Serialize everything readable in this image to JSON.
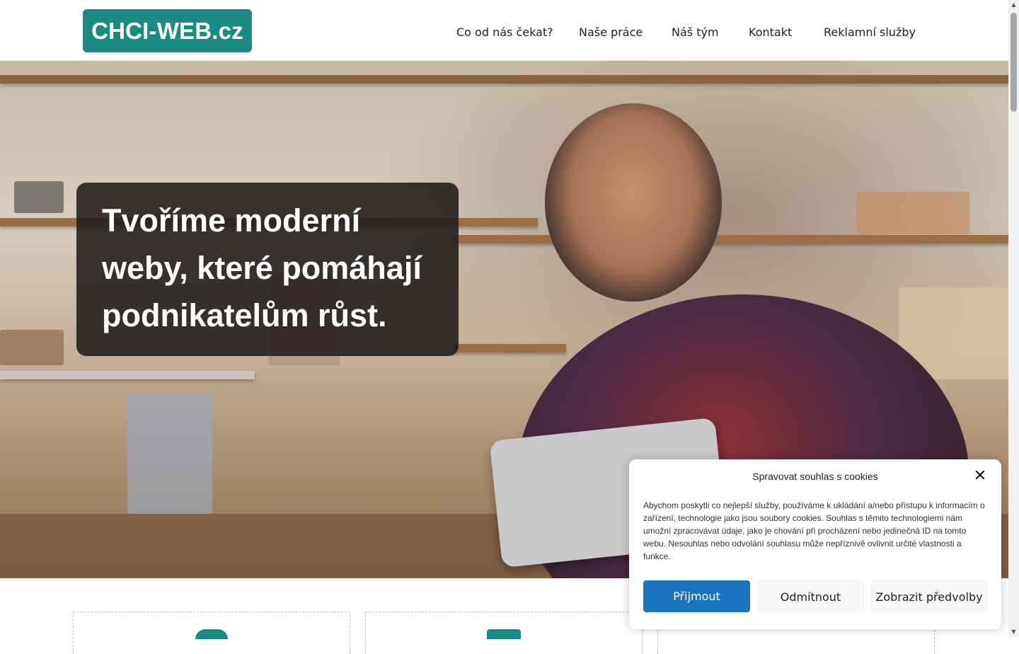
{
  "header": {
    "logo_text": "CHCI-WEB.cz",
    "nav": [
      "Co od nás čekat?",
      "Naše práce",
      "Náš tým",
      "Kontakt",
      "Reklamní služby"
    ]
  },
  "hero": {
    "title_lines": [
      "Tvoříme moderní",
      "weby, které pomáhají",
      "podnikatelům růst."
    ]
  },
  "cookie": {
    "title": "Spravovat souhlas s cookies",
    "text": "Abychom poskytli co nejlepší služby, používáme k ukládání a/nebo přístupu k informacím o zařízení, technologie jako jsou soubory cookies. Souhlas s těmito technologiemi nám umožní zpracovávat údaje, jako je chování při procházení nebo jedinečná ID na tomto webu. Nesouhlas nebo odvolání souhlasu může nepříznivě ovlivnit určité vlastnosti a funkce.",
    "accept": "Přijmout",
    "deny": "Odmítnout",
    "preferences": "Zobrazit předvolby"
  },
  "colors": {
    "brand": "#1a8a84",
    "accept_button": "#1e73be"
  }
}
